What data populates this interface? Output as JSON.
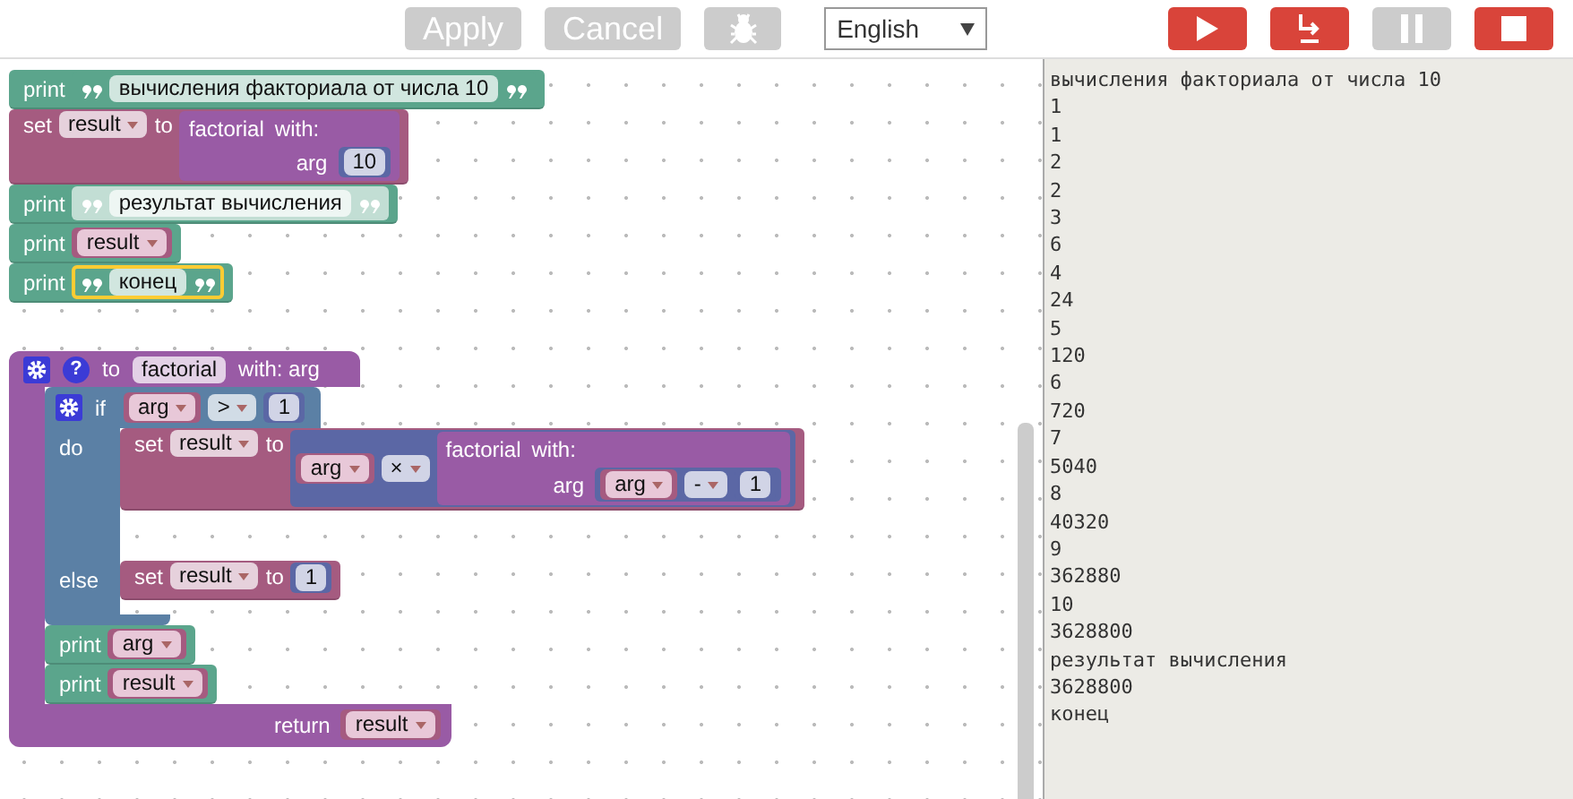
{
  "toolbar": {
    "buttons": [
      {
        "label": "Apply",
        "disabled": true
      },
      {
        "label": "Cancel",
        "disabled": true
      }
    ],
    "debug_button": {
      "disabled": true
    },
    "language": "English",
    "controls": [
      {
        "kind": "run",
        "disabled": false
      },
      {
        "kind": "step",
        "disabled": false
      },
      {
        "kind": "pause",
        "disabled": true
      },
      {
        "kind": "stop",
        "disabled": false
      }
    ]
  },
  "workspace": {
    "main_script": [
      {
        "kind": "print",
        "label": "print",
        "value": {
          "kind": "text",
          "text": "вычисления факториала от числа 10",
          "selected": false,
          "disabled": false
        }
      },
      {
        "kind": "set",
        "label": "set",
        "variable": "result",
        "to_label": "to",
        "value": {
          "kind": "call",
          "name": "factorial",
          "with_label": "with:",
          "param": "arg",
          "arg": {
            "kind": "number",
            "value": "10"
          }
        }
      },
      {
        "kind": "print",
        "label": "print",
        "value": {
          "kind": "text",
          "text": "результат вычисления",
          "selected": false,
          "disabled": true
        }
      },
      {
        "kind": "print",
        "label": "print",
        "value": {
          "kind": "variable",
          "name": "result"
        }
      },
      {
        "kind": "print",
        "label": "print",
        "value": {
          "kind": "text",
          "text": "конец",
          "selected": true,
          "disabled": false
        }
      }
    ],
    "function": {
      "to_label": "to",
      "help": "?",
      "name": "factorial",
      "params_label": "with: arg",
      "return_label": "return",
      "return_value": {
        "kind": "variable",
        "name": "result"
      },
      "body": [
        {
          "kind": "if",
          "if_label": "if",
          "condition": {
            "kind": "compare",
            "left": {
              "kind": "variable",
              "name": "arg"
            },
            "op": ">",
            "right": {
              "kind": "number",
              "value": "1"
            }
          },
          "do_label": "do",
          "do": [
            {
              "kind": "set",
              "label": "set",
              "variable": "result",
              "to_label": "to",
              "value": {
                "kind": "arithmetic",
                "left": {
                  "kind": "variable",
                  "name": "arg"
                },
                "op": "×",
                "right": {
                  "kind": "call",
                  "name": "factorial",
                  "with_label": "with:",
                  "param": "arg",
                  "arg": {
                    "kind": "arithmetic",
                    "left": {
                      "kind": "variable",
                      "name": "arg"
                    },
                    "op": "-",
                    "right": {
                      "kind": "number",
                      "value": "1"
                    }
                  }
                }
              }
            }
          ],
          "else_label": "else",
          "else": [
            {
              "kind": "set",
              "label": "set",
              "variable": "result",
              "to_label": "to",
              "value": {
                "kind": "number",
                "value": "1"
              }
            }
          ]
        },
        {
          "kind": "print",
          "label": "print",
          "value": {
            "kind": "variable",
            "name": "arg"
          }
        },
        {
          "kind": "print",
          "label": "print",
          "value": {
            "kind": "variable",
            "name": "result"
          }
        }
      ]
    }
  },
  "output": {
    "lines": [
      "вычисления факториала от числа 10",
      "1",
      "1",
      "2",
      "2",
      "3",
      "6",
      "4",
      "24",
      "5",
      "120",
      "6",
      "720",
      "7",
      "5040",
      "8",
      "40320",
      "9",
      "362880",
      "10",
      "3628800",
      "результат вычисления",
      "3628800",
      "конец"
    ]
  }
}
